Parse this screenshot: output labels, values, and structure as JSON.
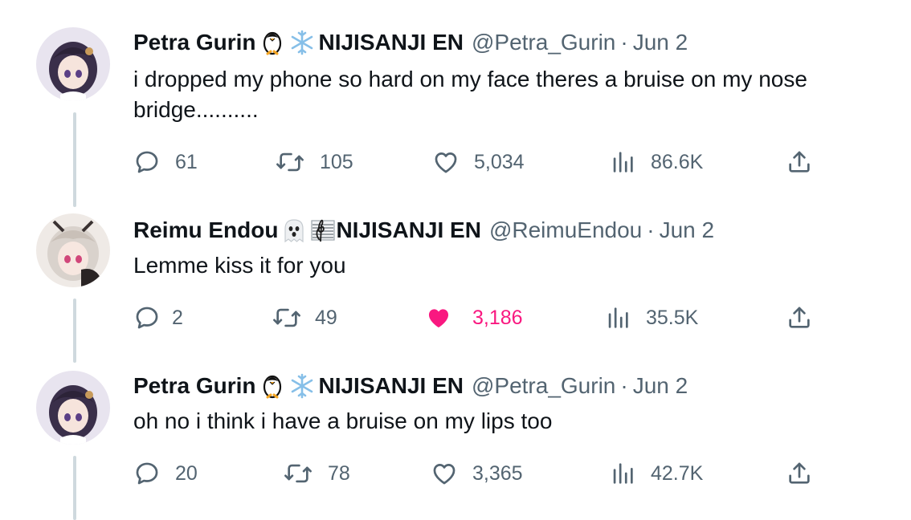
{
  "tweets": [
    {
      "name": "Petra Gurin",
      "name_suffix": "NIJISANJI EN",
      "handle": "@Petra_Gurin",
      "separator": "·",
      "date": "Jun 2",
      "text": "i dropped my phone so hard on my face theres a bruise on my nose bridge..........",
      "replies": "61",
      "reposts": "105",
      "likes": "5,034",
      "views": "86.6K",
      "liked": false,
      "emojis": [
        "penguin-icon",
        "snowflake-icon"
      ]
    },
    {
      "name": "Reimu Endou",
      "name_suffix": "NIJISANJI EN",
      "handle": "@ReimuEndou",
      "separator": "·",
      "date": "Jun 2",
      "text": "Lemme kiss it for you",
      "replies": "2",
      "reposts": "49",
      "likes": "3,186",
      "views": "35.5K",
      "liked": true,
      "emojis": [
        "ghost-icon",
        "musical-score-icon"
      ]
    },
    {
      "name": "Petra Gurin",
      "name_suffix": "NIJISANJI EN",
      "handle": "@Petra_Gurin",
      "separator": "·",
      "date": "Jun 2",
      "text": "oh no i think i have a bruise on my lips too",
      "replies": "20",
      "reposts": "78",
      "likes": "3,365",
      "views": "42.7K",
      "liked": false,
      "emojis": [
        "penguin-icon",
        "snowflake-icon"
      ]
    }
  ],
  "colors": {
    "text": "#0f1419",
    "secondary": "#536471",
    "like_active": "#f91880",
    "thread_line": "#cfd9de"
  }
}
